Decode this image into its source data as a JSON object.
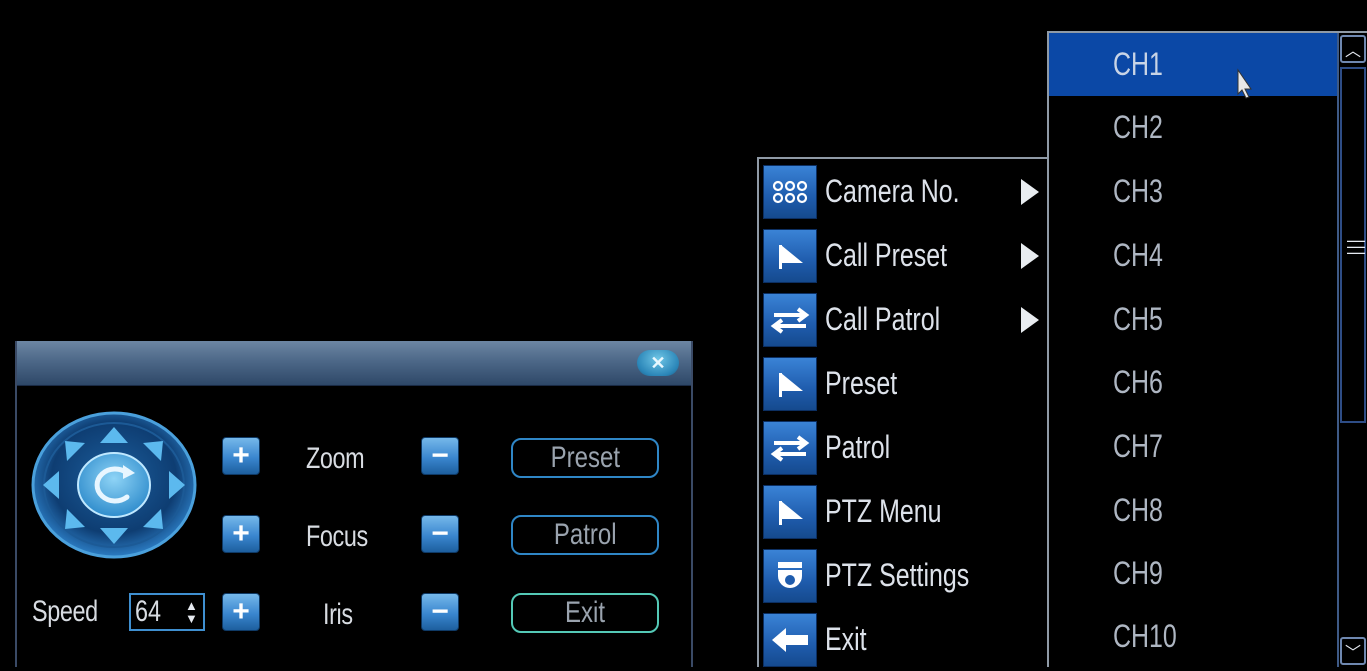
{
  "ptz_panel": {
    "close_icon": "close-x-icon",
    "zoom_label": "Zoom",
    "focus_label": "Focus",
    "iris_label": "Iris",
    "speed_label": "Speed",
    "speed_value": "64",
    "preset_button": "Preset",
    "patrol_button": "Patrol",
    "exit_button": "Exit",
    "plus_glyph": "+",
    "minus_glyph": "−"
  },
  "context_menu": {
    "items": [
      {
        "label": "Camera No.",
        "icon": "camera-grid-icon",
        "has_submenu": true
      },
      {
        "label": "Call Preset",
        "icon": "flag-icon",
        "has_submenu": true
      },
      {
        "label": "Call Patrol",
        "icon": "patrol-arrows-icon",
        "has_submenu": true
      },
      {
        "label": "Preset",
        "icon": "flag-icon",
        "has_submenu": false
      },
      {
        "label": "Patrol",
        "icon": "patrol-arrows-icon",
        "has_submenu": false
      },
      {
        "label": "PTZ Menu",
        "icon": "flag-icon",
        "has_submenu": false
      },
      {
        "label": "PTZ Settings",
        "icon": "dome-camera-icon",
        "has_submenu": false
      },
      {
        "label": "Exit",
        "icon": "back-arrow-icon",
        "has_submenu": false
      }
    ]
  },
  "channel_menu": {
    "selected": "CH1",
    "items": [
      "CH1",
      "CH2",
      "CH3",
      "CH4",
      "CH5",
      "CH6",
      "CH7",
      "CH8",
      "CH9",
      "CH10"
    ]
  },
  "colors": {
    "background": "#000000",
    "selection": "#0b48a6",
    "accent": "#2f86c6"
  }
}
